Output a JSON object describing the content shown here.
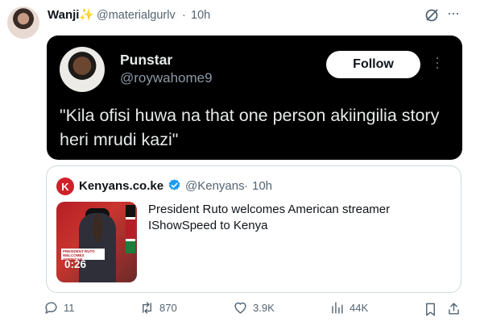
{
  "post": {
    "author_name": "Wanji",
    "author_emoji": "✨",
    "handle": "@materialgurlv",
    "separator": "·",
    "time": "10h"
  },
  "embedded_post": {
    "name": "Punstar",
    "handle": "@roywahome9",
    "follow_label": "Follow",
    "text": "\"Kila ofisi huwa na that one person akiingilia story heri mrudi kazi\""
  },
  "quote": {
    "logo_letter": "K",
    "name": "Kenyans.co.ke",
    "handle": "@Kenyans",
    "separator": "·",
    "time": "10h",
    "title": "President Ruto welcomes American streamer IShowSpeed to Kenya",
    "video_duration": "0:26",
    "banner_text": "PRESIDENT RUTO WELCOMES AMERICAN"
  },
  "actions": {
    "replies": "11",
    "reposts": "870",
    "likes": "3.9K",
    "views": "44K"
  },
  "icons": [
    "grok-icon",
    "more-icon",
    "verified-icon",
    "reply-icon",
    "repost-icon",
    "like-icon",
    "views-icon",
    "bookmark-icon",
    "share-icon"
  ],
  "colors": {
    "accent": "#1d9bf0",
    "muted": "#536471",
    "brand_red": "#d0202a"
  }
}
